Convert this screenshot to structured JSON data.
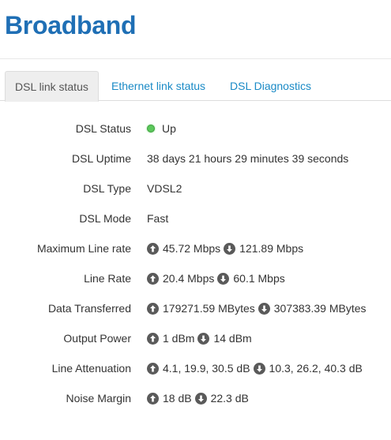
{
  "page": {
    "title": "Broadband"
  },
  "tabs": [
    {
      "label": "DSL link status"
    },
    {
      "label": "Ethernet link status"
    },
    {
      "label": "DSL Diagnostics"
    }
  ],
  "status": {
    "dsl_status": {
      "label": "DSL Status",
      "value": "Up",
      "indicator_color": "#5cc85c"
    },
    "dsl_uptime": {
      "label": "DSL Uptime",
      "value": "38 days 21 hours 29 minutes 39 seconds"
    },
    "dsl_type": {
      "label": "DSL Type",
      "value": "VDSL2"
    },
    "dsl_mode": {
      "label": "DSL Mode",
      "value": "Fast"
    },
    "max_line_rate": {
      "label": "Maximum Line rate",
      "up": "45.72 Mbps",
      "down": "121.89 Mbps"
    },
    "line_rate": {
      "label": "Line Rate",
      "up": "20.4 Mbps",
      "down": "60.1 Mbps"
    },
    "data_transferred": {
      "label": "Data Transferred",
      "up": "179271.59 MBytes",
      "down": "307383.39 MBytes"
    },
    "output_power": {
      "label": "Output Power",
      "up": "1 dBm",
      "down": "14 dBm"
    },
    "line_attenuation": {
      "label": "Line Attenuation",
      "up": "4.1, 19.9, 30.5 dB",
      "down": "10.3, 26.2, 40.3 dB"
    },
    "noise_margin": {
      "label": "Noise Margin",
      "up": "18 dB",
      "down": "22.3 dB"
    }
  },
  "icons": {
    "up": "arrow-up-circle-icon",
    "down": "arrow-down-circle-icon"
  }
}
